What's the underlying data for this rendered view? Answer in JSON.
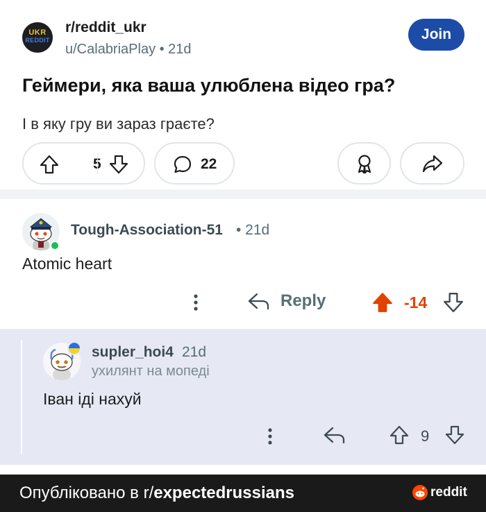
{
  "post": {
    "subreddit_avatar_line1": "UKR",
    "subreddit_avatar_line2": "REDDIT",
    "subreddit": "r/reddit_ukr",
    "meta": "u/CalabriaPlay • 21d",
    "join_label": "Join",
    "title": "Геймери,  яка ваша улюблена відео гра?",
    "body": "І в яку гру ви зараз граєте?",
    "vote_count": "5",
    "comment_count": "22"
  },
  "comment1": {
    "author": "Tough-Association-51",
    "time": "• 21d",
    "text": "Atomic heart",
    "reply_label": "Reply",
    "score": "-14"
  },
  "comment2": {
    "author": "supler_hoi4",
    "time": "21d",
    "flair": "ухилянт на мопеді",
    "text": "Іван іді нахуй",
    "score": "9"
  },
  "footer": {
    "prefix": "Опубліковано в r/",
    "subreddit": "expectedrussians",
    "brand": "reddit"
  },
  "colors": {
    "join_button": "#1d4ca8",
    "upvoted": "#e04200",
    "reply_bg": "#e6e9f4",
    "online": "#18bf5c",
    "footer_bg": "#1a1a1b"
  }
}
